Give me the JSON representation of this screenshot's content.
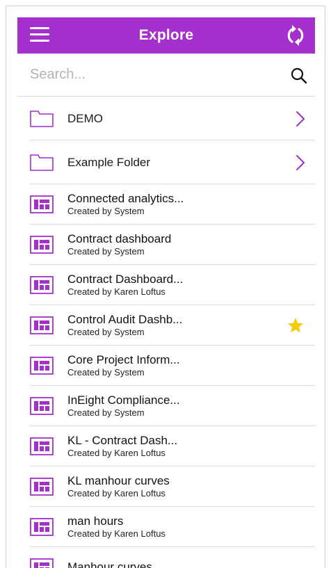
{
  "header": {
    "title": "Explore"
  },
  "search": {
    "placeholder": "Search..."
  },
  "folders": [
    {
      "label": "DEMO"
    },
    {
      "label": "Example Folder"
    }
  ],
  "dashboards": [
    {
      "name": "Connected analytics...",
      "created_by": "Created by System",
      "favorite": false
    },
    {
      "name": "Contract dashboard",
      "created_by": "Created by System",
      "favorite": false
    },
    {
      "name": "Contract Dashboard...",
      "created_by": "Created by Karen Loftus",
      "favorite": false
    },
    {
      "name": "Control Audit Dashb...",
      "created_by": "Created by System",
      "favorite": true
    },
    {
      "name": "Core Project Inform...",
      "created_by": "Created by System",
      "favorite": false
    },
    {
      "name": "InEight Compliance...",
      "created_by": "Created by System",
      "favorite": false
    },
    {
      "name": "KL - Contract Dash...",
      "created_by": "Created by Karen Loftus",
      "favorite": false
    },
    {
      "name": "KL manhour curves",
      "created_by": "Created by Karen Loftus",
      "favorite": false
    },
    {
      "name": "man hours",
      "created_by": "Created by Karen Loftus",
      "favorite": false
    },
    {
      "name": "Manhour curves",
      "created_by": "",
      "favorite": false
    }
  ],
  "colors": {
    "accent": "#a52fcc",
    "star": "#f5cc00"
  },
  "icons": {
    "menu": "hamburger-menu-icon",
    "refresh": "refresh-icon",
    "search": "search-icon",
    "folder": "folder-icon",
    "dashboard": "dashboard-icon",
    "chevron": "chevron-right-icon",
    "favorite": "star-icon"
  }
}
